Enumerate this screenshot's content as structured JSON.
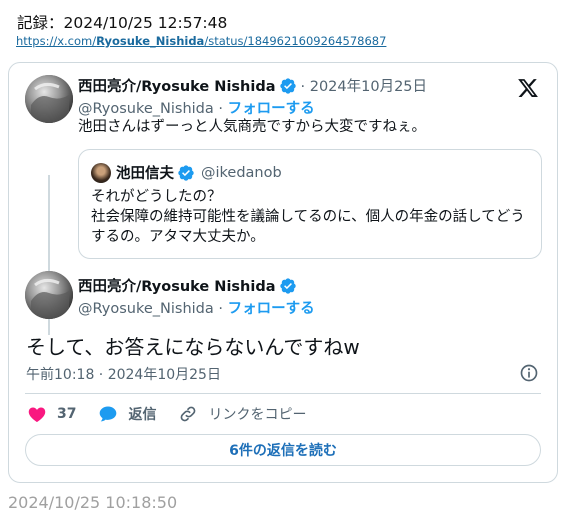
{
  "record": "記録：2024/10/25 12:57:48",
  "url": {
    "prefix": "https://x.com/",
    "user": "Ryosuke_Nishida",
    "suffix": "/status/1849621609264578687"
  },
  "tweet1": {
    "name": "西田亮介/Ryosuke Nishida",
    "date": "· 2024年10月25日",
    "handle": "@Ryosuke_Nishida ·",
    "follow": "フォローする",
    "text": "池田さんはずーっと人気商売ですから大変ですねぇ。"
  },
  "quote": {
    "name": "池田信夫",
    "handle": "@ikedanob",
    "line1": "それがどうしたの？",
    "line2": "社会保障の維持可能性を議論してるのに、個人の年金の話してどうするの。アタマ大丈夫か。"
  },
  "tweet2": {
    "name": "西田亮介/Ryosuke Nishida",
    "handle": "@Ryosuke_Nishida ·",
    "follow": "フォローする",
    "text": "そして、お答えにならないんですねw",
    "meta": "午前10:18 · 2024年10月25日"
  },
  "actions": {
    "likes": "37",
    "reply": "返信",
    "copy_link": "リンクをコピー"
  },
  "read_replies": "6件の返信を読む",
  "footer_timestamp": "2024/10/25 10:18:50",
  "colors": {
    "accent": "#1d9bf0",
    "like": "#f91880",
    "text": "#0f1419",
    "muted": "#536471",
    "border": "#cfd9de"
  }
}
